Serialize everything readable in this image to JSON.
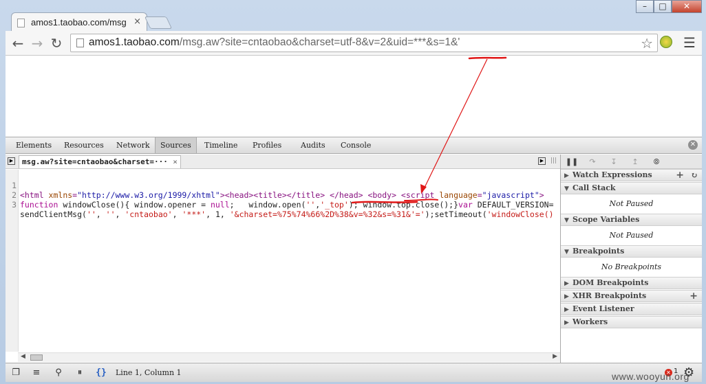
{
  "window": {
    "tab_title": "amos1.taobao.com/msg",
    "tab_close": "×",
    "buttons": {
      "minimize": "–",
      "maximize": "□",
      "close": "✕"
    }
  },
  "toolbar": {
    "url_host": "amos1.taobao.com",
    "url_rest": "/msg.aw?site=cntaobao&charset=utf-8&v=2&uid=***&s=1&'",
    "icons": [
      "back-arrow-icon",
      "forward-arrow-icon",
      "reload-icon",
      "favicon-page-icon",
      "bookmark-star-icon",
      "extension-icon",
      "menu-icon"
    ]
  },
  "devtools": {
    "tabs": [
      "Elements",
      "Resources",
      "Network",
      "Sources",
      "Timeline",
      "Profiles",
      "Audits",
      "Console"
    ],
    "active_tab": "Sources",
    "file_tab": "msg.aw?site=cntaobao&charset=···",
    "code_lines": [
      {
        "num": "1"
      },
      {
        "num": "2"
      },
      {
        "num": "3"
      }
    ],
    "status_text": "Line 1, Column 1",
    "error_count": "1"
  },
  "sidebar": {
    "sections": [
      {
        "title": "Watch Expressions"
      },
      {
        "title": "Call Stack",
        "body": "Not Paused"
      },
      {
        "title": "Scope Variables",
        "body": "Not Paused"
      },
      {
        "title": "Breakpoints",
        "body": "No Breakpoints"
      },
      {
        "title": "DOM Breakpoints"
      },
      {
        "title": "XHR Breakpoints"
      },
      {
        "title": "Event Listener"
      },
      {
        "title": "Workers"
      }
    ]
  },
  "code": {
    "l1": [
      "<html ",
      "xmlns",
      "=",
      "\"http://www.w3.org/1999/xhtml\"",
      "><head><title></title> </head> <body> <script ",
      "language",
      "=",
      "\"javascript\"",
      ">"
    ],
    "l2": [
      "function",
      " windowClose(){ window.opener = ",
      "null",
      ";   window.open(",
      "''",
      ",",
      "'_top'",
      "); window.top.close();}",
      "var",
      " DEFAULT_VERSION="
    ],
    "l3": [
      "sendClientMsg(",
      "''",
      ", ",
      "''",
      ", ",
      "'cntaobao'",
      ", ",
      "'***'",
      ", 1, ",
      "'&charset=%75%74%66%2D%38&v=%32&s=%31&'='",
      ");setTimeout(",
      "'windowClose()"
    ]
  },
  "watermark": "www.wooyun.org",
  "colors": {
    "annotation": "#e01616",
    "accent_blue": "#2b62c4"
  }
}
